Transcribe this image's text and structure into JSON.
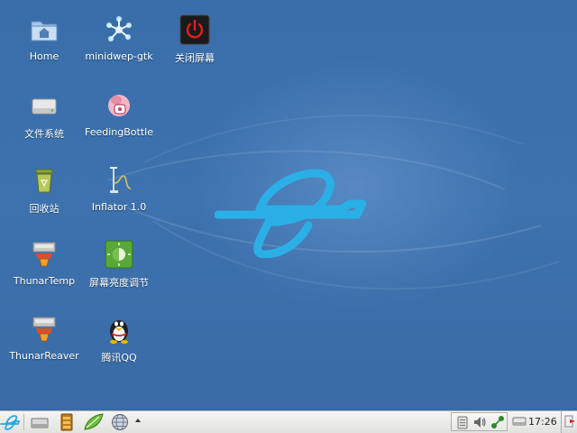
{
  "desktop": {
    "icons": [
      {
        "label": "Home",
        "icon": "home-folder-icon"
      },
      {
        "label": "minidwep-gtk",
        "icon": "minidwep-icon"
      },
      {
        "label": "关闭屏幕",
        "icon": "power-off-icon"
      },
      {
        "label": "文件系统",
        "icon": "drive-icon"
      },
      {
        "label": "FeedingBottle",
        "icon": "feeding-bottle-icon"
      },
      {
        "label": "回收站",
        "icon": "trash-icon"
      },
      {
        "label": "Inflator 1.0",
        "icon": "inflator-icon"
      },
      {
        "label": "ThunarTemp",
        "icon": "thunar-temp-icon"
      },
      {
        "label": "屏幕亮度调节",
        "icon": "brightness-icon"
      },
      {
        "label": "ThunarReaver",
        "icon": "thunar-reaver-icon"
      },
      {
        "label": "腾讯QQ",
        "icon": "qq-penguin-icon"
      }
    ]
  },
  "taskbar": {
    "launchers": [
      "start-menu-icon",
      "show-desktop-icon",
      "file-manager-icon",
      "text-editor-icon",
      "web-browser-icon",
      "launcher-expand-icon"
    ],
    "tray": [
      "clipboard-icon",
      "volume-icon",
      "network-icon",
      "removable-drive-icon"
    ],
    "clock": "17:26"
  },
  "colors": {
    "desktop_bg": "#3d72ae",
    "logo_cyan": "#29a9e0",
    "taskbar_bg": "#ececea"
  }
}
